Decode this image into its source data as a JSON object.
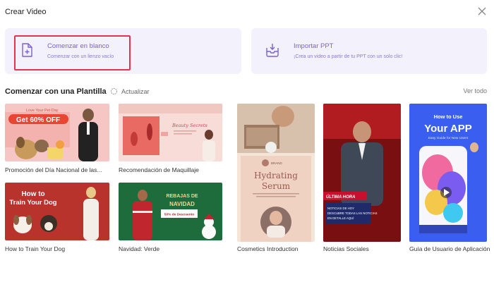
{
  "window": {
    "title": "Crear Video"
  },
  "blank_card": {
    "title": "Comenzar en blanco",
    "subtitle": "Comenzar con un lienzo vacío"
  },
  "import_card": {
    "title": "Importar PPT",
    "subtitle": "¡Crea un video a partir de tu PPT con un solo clic!"
  },
  "templates_section": {
    "title": "Comenzar con una Plantilla",
    "refresh_label": "Actualizar",
    "see_all_label": "Ver todo"
  },
  "templates": [
    {
      "caption": "Promoción del Día Nacional de las...",
      "text1": "Love Your Pet Day",
      "text2": "Get 60% OFF"
    },
    {
      "caption": "Recomendación de Maquillaje",
      "text1": "Beauty Secrets"
    },
    {
      "caption": "How to Train Your Dog",
      "text1": "How to",
      "text2": "Train Your Dog"
    },
    {
      "caption": "Navidad: Verde",
      "text1": "REBAJAS DE",
      "text2": "NAVIDAD",
      "text3": "50% de Descuento"
    },
    {
      "caption": "Cosmetics Introduction",
      "text1": "BRAND",
      "text2": "Hydrating",
      "text3": "Serum"
    },
    {
      "caption": "Noticias Sociales",
      "text1": "ÚLTIMA HORA",
      "text2": "NOTICIAS DE HOY",
      "text3": "DESCUBRE TODAS LAS NOTICIAS",
      "text4": "EN DETALLE AQUÍ"
    },
    {
      "caption": "Guía de Usuario de Aplicación",
      "text1": "How to Use",
      "text2": "Your APP",
      "text3": "Easy Guide for New Users"
    }
  ],
  "colors": {
    "accent": "#7b61d1",
    "card_bg": "#f3f1fc",
    "selection": "#e8334f"
  }
}
